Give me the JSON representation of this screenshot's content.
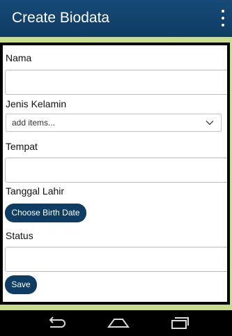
{
  "appbar": {
    "title": "Create Biodata",
    "menu_icon": "more-vert-icon"
  },
  "form": {
    "nama_label": "Nama",
    "nama_value": "",
    "jenis_kelamin_label": "Jenis Kelamin",
    "jenis_kelamin_value": "add items...",
    "tempat_label": "Tempat",
    "tempat_value": "",
    "tanggal_lahir_label": "Tanggal Lahir",
    "choose_date_label": "Choose Birth Date",
    "status_label": "Status",
    "status_value": "",
    "save_label": "Save"
  },
  "colors": {
    "primary": "#0e3c63",
    "background": "#c9dd8d"
  },
  "navbar": {
    "back_icon": "back-icon",
    "home_icon": "home-icon",
    "recents_icon": "recents-icon"
  }
}
